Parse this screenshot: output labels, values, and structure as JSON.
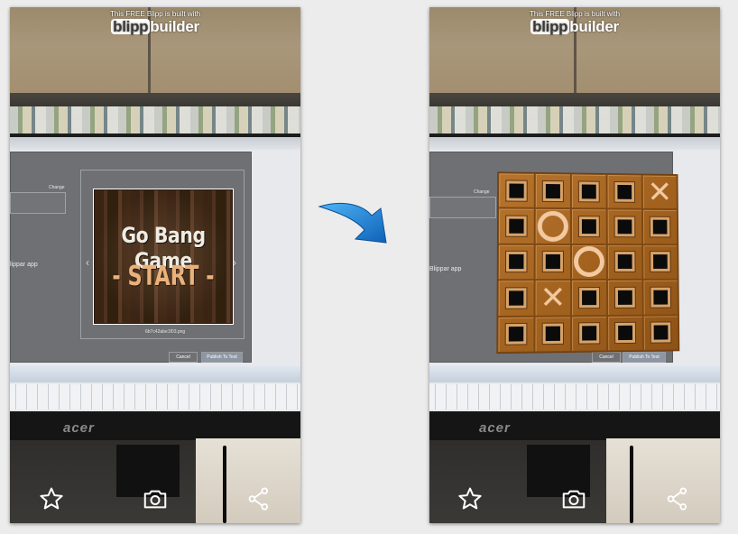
{
  "header": {
    "tagline": "This FREE Blipp is built with",
    "logo_left": "blipp",
    "logo_right": "builder"
  },
  "monitor": {
    "brand": "acer"
  },
  "screen": {
    "change_label": "Change",
    "app_label_left": "lippar app",
    "app_label_right": "Blippar app",
    "filename": "6b7c42abe1f03.png",
    "cancel_label": "Cancel",
    "publish_label": "Publish To Test"
  },
  "left_card": {
    "title": "Go Bang Game",
    "start_label": "- START -",
    "prev_icon": "chevron-left-icon",
    "next_icon": "chevron-right-icon"
  },
  "board": {
    "size": 5,
    "marks": [
      [
        "",
        "",
        "",
        "",
        "X"
      ],
      [
        "",
        "O",
        "",
        "",
        ""
      ],
      [
        "",
        "",
        "O",
        "",
        ""
      ],
      [
        "",
        "X",
        "",
        "",
        ""
      ],
      [
        "",
        "",
        "",
        "",
        ""
      ]
    ]
  },
  "toolbar": {
    "icons": [
      "star-icon",
      "camera-icon",
      "share-icon"
    ]
  },
  "transition": {
    "icon": "arrow-right-icon",
    "color": "#1e8fe6"
  },
  "colors": {
    "board_wood": "#a3631f",
    "mark": "#f2c9a0",
    "bar": "#3c3a37"
  }
}
